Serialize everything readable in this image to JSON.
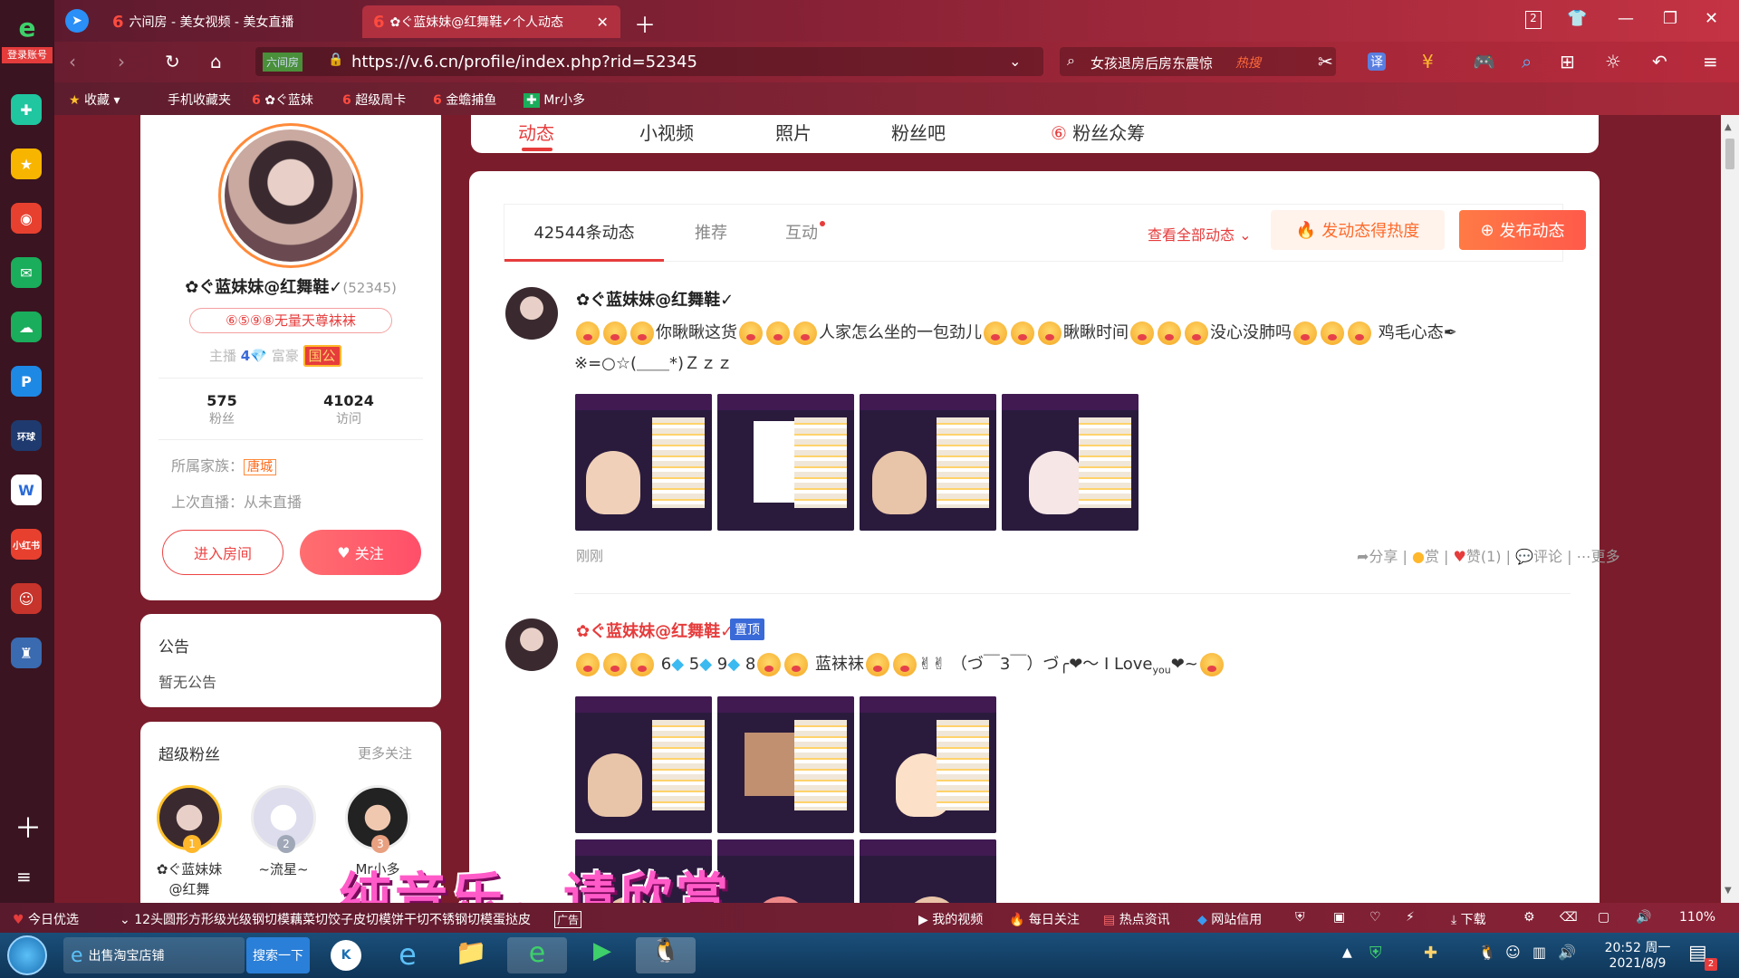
{
  "browser": {
    "tabs": [
      {
        "title": "六间房 - 美女视频 - 美女直播"
      },
      {
        "title": "✿ぐ蓝妹妹@红舞鞋✓个人动态"
      }
    ],
    "win_number": "2",
    "url_site_tag": "六间房",
    "url": "https://v.6.cn/profile/index.php?rid=52345",
    "search_text": "女孩退房后房东震惊",
    "search_hot": "热搜",
    "translate_label": "译",
    "left_login_label": "登录账号"
  },
  "bookmarks": [
    {
      "label": "收藏"
    },
    {
      "label": "手机收藏夹"
    },
    {
      "label": "✿ぐ蓝妹"
    },
    {
      "label": "超级周卡"
    },
    {
      "label": "金蟾捕鱼"
    },
    {
      "label": "Mr小多"
    }
  ],
  "leftbar_icons": [
    "add-icon-label",
    "menu"
  ],
  "profile": {
    "top_tabs": [
      "动态",
      "小视频",
      "照片",
      "粉丝吧",
      "粉丝众筹"
    ],
    "name": "✿ぐ蓝妹妹@红舞鞋✓",
    "rid": "(52345)",
    "title_badge": "⑥⑤⑨⑧无量天尊袜袜",
    "anchor_label": "主播",
    "anchor_level": "4",
    "rich_label": "富豪",
    "rich_badge": "国公",
    "fans_count": "575",
    "fans_label": "粉丝",
    "visits_count": "41024",
    "visits_label": "访问",
    "family_label": "所属家族：",
    "family_value": "唐城",
    "last_live": "上次直播：从未直播",
    "enter_room": "进入房间",
    "follow": "关注"
  },
  "notice": {
    "title": "公告",
    "content": "暂无公告"
  },
  "super_fans": {
    "title": "超级粉丝",
    "more": "更多关注",
    "fans": [
      {
        "rank": "1",
        "name": "✿ぐ蓝妹妹@红舞"
      },
      {
        "rank": "2",
        "name": "~流星~"
      },
      {
        "rank": "3",
        "name": "Mr小多"
      }
    ]
  },
  "feed": {
    "tabs": [
      "42544条动态",
      "推荐",
      "互动"
    ],
    "view_all": "查看全部动态",
    "hot_button": "发动态得热度",
    "post_button": "发布动态",
    "posts": [
      {
        "author": "✿ぐ蓝妹妹@红舞鞋✓",
        "line1_parts": [
          "你瞅瞅这货",
          "人家怎么坐的一包劲儿",
          "瞅瞅时间",
          "没心没肺吗",
          "鸡毛心态"
        ],
        "line2": "※=○☆(＿＿*)Ｚｚｚ",
        "time": "刚刚",
        "share": "分享",
        "reward": "赏",
        "like": "赞(1)",
        "comment": "评论",
        "more": "更多"
      },
      {
        "author": "✿ぐ蓝妹妹@红舞鞋✓",
        "pinned": "置顶",
        "content_parts": [
          "6",
          "5",
          "9",
          "8",
          "蓝袜袜",
          "（づ￣3￣）づ╭❤～ I Love",
          "you",
          "❤~"
        ]
      }
    ]
  },
  "overlay_subtitle": "纯音乐，请欣赏",
  "statusbar": {
    "today": "今日优选",
    "ad": "12头圆形方形级光级钢切模藕菜切饺子皮切模饼干切不锈钢切模蛋挞皮",
    "ad_tag": "广告",
    "my_video": "我的视频",
    "daily": "每日关注",
    "hot_news": "热点资讯",
    "credit": "网站信用",
    "download": "下载",
    "zoom": "110%"
  },
  "taskbar": {
    "ie_task": "出售淘宝店铺",
    "search_btn": "搜索一下",
    "time": "20:52 周一",
    "date": "2021/8/9",
    "notif_count": "2"
  },
  "colors": {
    "accent": "#ff4f5f",
    "brand_red": "#e63c3c",
    "hot_orange": "#ff7a45"
  }
}
